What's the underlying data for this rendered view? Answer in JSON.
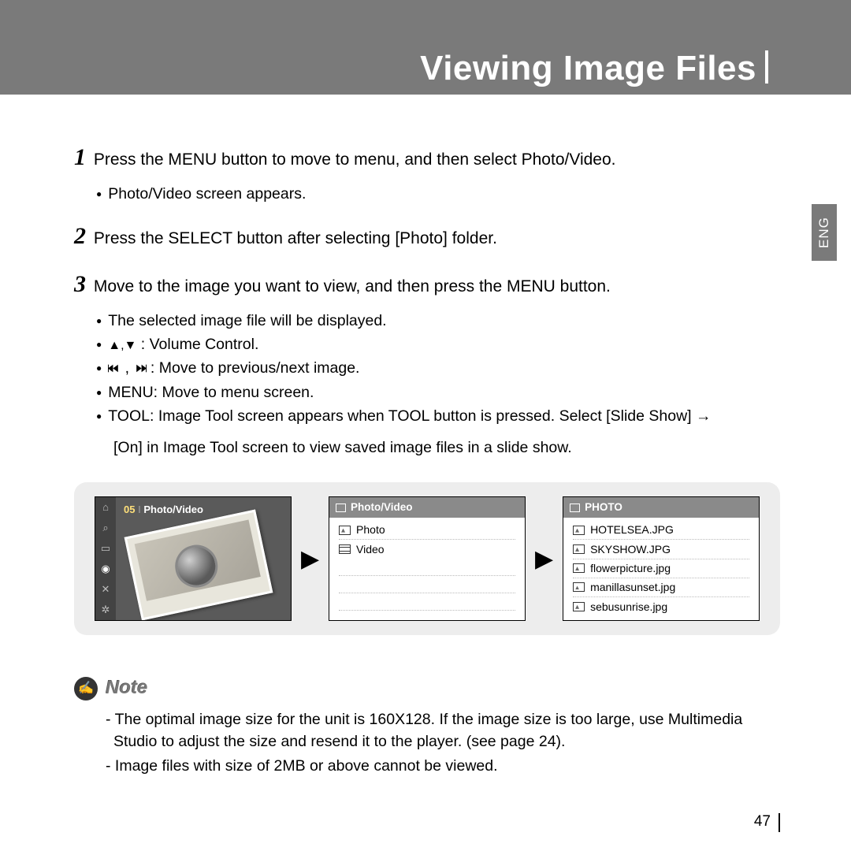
{
  "title": "Viewing Image Files",
  "langTab": "ENG",
  "pageNumber": "47",
  "steps": {
    "s1": "Press the MENU button to move to menu, and then select Photo/Video.",
    "s1_sub1": "Photo/Video screen appears.",
    "s2": "Press the SELECT button after selecting [Photo] folder.",
    "s3": "Move to the image you want to view, and then press the MENU button.",
    "s3_sub1": "The selected image file will be displayed.",
    "s3_sub2_suffix": " : Volume Control.",
    "s3_sub3_suffix": " : Move to previous/next image.",
    "s3_sub4": "MENU: Move to menu screen.",
    "s3_sub5": "TOOL: Image Tool screen appears when TOOL button is pressed. Select [Slide Show] →",
    "s3_sub5_cont": "[On] in Image Tool screen to view saved image files in a slide show."
  },
  "screen1": {
    "num": "05",
    "label": "Photo/Video"
  },
  "screen2": {
    "header": "Photo/Video",
    "items": [
      {
        "type": "img",
        "label": "Photo"
      },
      {
        "type": "vid",
        "label": "Video"
      }
    ]
  },
  "screen3": {
    "header": "PHOTO",
    "items": [
      {
        "label": "HOTELSEA.JPG"
      },
      {
        "label": "SKYSHOW.JPG"
      },
      {
        "label": "flowerpicture.jpg"
      },
      {
        "label": "manillasunset.jpg"
      },
      {
        "label": "sebusunrise.jpg"
      }
    ]
  },
  "note": {
    "label": "Note",
    "n1": "The optimal image size for the unit is 160X128. If the image size is too large, use Multimedia Studio to adjust the size and resend it to the player. (see page 24).",
    "n2": "Image files with size of 2MB or above cannot be viewed."
  }
}
